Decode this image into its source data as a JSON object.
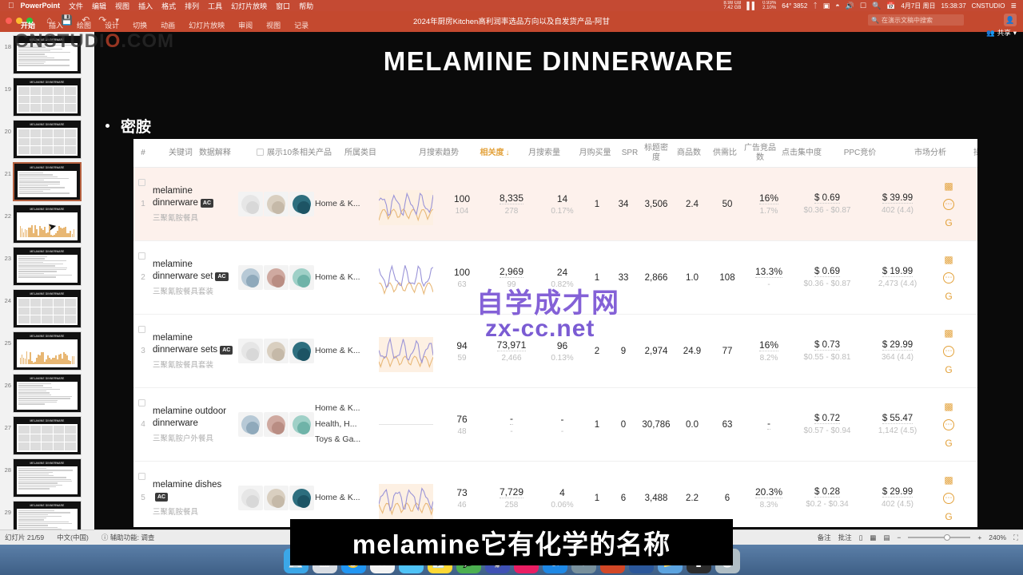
{
  "macos_menubar": {
    "apple_icon": "apple-icon",
    "app_name": "PowerPoint",
    "menus": [
      "文件",
      "编辑",
      "视图",
      "插入",
      "格式",
      "排列",
      "工具",
      "幻灯片放映",
      "窗口",
      "帮助"
    ],
    "net_up": "8.98 GB",
    "net_down": "7.42 GB",
    "cpu_pct": "0.93%",
    "mem_pct": "2.10%",
    "temp": "64° 3852",
    "date": "4月7日 周日",
    "time": "15:38:37",
    "user": "CNSTUDIO",
    "status_icons": [
      "bluetooth-icon",
      "display-icon",
      "wifi-icon",
      "volume-icon",
      "screenmirror-icon",
      "spotlight-icon",
      "controlcenter-icon",
      "list-icon"
    ]
  },
  "ppt_window": {
    "quick_access": [
      "home-icon",
      "save-icon",
      "undo-icon",
      "redo-icon",
      "more-icon"
    ],
    "document_title": "2024年厨房Kitchen高利润率选品方向以及自发货产品-阿甘",
    "search_placeholder": "在演示文稿中搜索",
    "share_label": "共享",
    "avatar_icon": "avatar-icon",
    "ribbon_tabs": [
      "开始",
      "插入",
      "绘图",
      "设计",
      "切换",
      "动画",
      "幻灯片放映",
      "审阅",
      "视图",
      "记录"
    ],
    "active_tab": "开始"
  },
  "slide_panel": {
    "thumbnails": [
      {
        "num": "18",
        "selected": false,
        "style": "doc"
      },
      {
        "num": "19",
        "selected": false,
        "style": "grid"
      },
      {
        "num": "20",
        "selected": false,
        "style": "grid"
      },
      {
        "num": "21",
        "selected": true,
        "style": "table"
      },
      {
        "num": "22",
        "selected": false,
        "style": "chart"
      },
      {
        "num": "23",
        "selected": false,
        "style": "table"
      },
      {
        "num": "24",
        "selected": false,
        "style": "grid"
      },
      {
        "num": "25",
        "selected": false,
        "style": "chart"
      },
      {
        "num": "26",
        "selected": false,
        "style": "doc"
      },
      {
        "num": "27",
        "selected": false,
        "style": "grid"
      },
      {
        "num": "28",
        "selected": false,
        "style": "doc"
      },
      {
        "num": "29",
        "selected": false,
        "style": "doc"
      }
    ]
  },
  "slide": {
    "title": "MELAMINE DINNERWARE",
    "bullet_text": "密胺",
    "watermark_logo": "CNSTUDIO.COM",
    "watermark_cn": "自学成才网",
    "watermark_url": "zx-cc.net"
  },
  "table": {
    "headers": {
      "index": "#",
      "keyword": "关键词",
      "data_explain": "数据解释",
      "show_related": "展示10条相关产品",
      "category": "所属类目",
      "trend": "月搜索趋势",
      "relevance": "相关度",
      "sort_arrow": "↓",
      "search_volume": "月搜索量",
      "purchase_volume": "月购买量",
      "spr": "SPR",
      "title_density": "标题密度",
      "goods_count": "商品数",
      "supply_demand": "供需比",
      "ad_competitors": "广告竞品数",
      "click_concentration": "点击集中度",
      "ppc_bid": "PPC竞价",
      "market_analysis": "市场分析",
      "actions": "操作"
    },
    "rows": [
      {
        "index": "1",
        "keyword_en": "melamine dinnerware",
        "badge": "AC",
        "keyword_cn": "三聚氰胺餐具",
        "categories": [
          "Home & K..."
        ],
        "relevance": "100",
        "relevance_sub": "104",
        "search_volume": "8,335",
        "search_volume_sub": "278",
        "purchase_volume": "14",
        "purchase_volume_sub": "0.17%",
        "spr": "1",
        "title_density": "34",
        "goods_count": "3,506",
        "supply_demand": "2.4",
        "ad_competitors": "50",
        "click_concentration": "16%",
        "click_concentration_sub": "1.7%",
        "ppc_bid": "$ 0.69",
        "ppc_range": "$0.36 - $0.87",
        "market_price": "$ 39.99",
        "market_sub": "402 (4.4)",
        "highlighted": true
      },
      {
        "index": "2",
        "keyword_en": "melamine dinnerware set",
        "badge": "AC",
        "keyword_cn": "三聚氰胺餐具套装",
        "categories": [
          "Home & K..."
        ],
        "relevance": "100",
        "relevance_sub": "63",
        "search_volume": "2,969",
        "search_volume_sub": "99",
        "purchase_volume": "24",
        "purchase_volume_sub": "0.82%",
        "spr": "1",
        "title_density": "33",
        "goods_count": "2,866",
        "supply_demand": "1.0",
        "ad_competitors": "108",
        "click_concentration": "13.3%",
        "click_concentration_sub": "-",
        "ppc_bid": "$ 0.69",
        "ppc_range": "$0.36 - $0.87",
        "market_price": "$ 19.99",
        "market_sub": "2,473 (4.4)",
        "highlighted": false
      },
      {
        "index": "3",
        "keyword_en": "melamine dinnerware sets",
        "badge": "AC",
        "keyword_cn": "三聚氰胺餐具套装",
        "categories": [
          "Home & K..."
        ],
        "relevance": "94",
        "relevance_sub": "59",
        "search_volume": "73,971",
        "search_volume_sub": "2,466",
        "purchase_volume": "96",
        "purchase_volume_sub": "0.13%",
        "spr": "2",
        "title_density": "9",
        "goods_count": "2,974",
        "supply_demand": "24.9",
        "ad_competitors": "77",
        "click_concentration": "16%",
        "click_concentration_sub": "8.2%",
        "ppc_bid": "$ 0.73",
        "ppc_range": "$0.55 - $0.81",
        "market_price": "$ 29.99",
        "market_sub": "364 (4.4)",
        "highlighted": false
      },
      {
        "index": "4",
        "keyword_en": "melamine outdoor dinnerware",
        "badge": "",
        "keyword_cn": "三聚氰胺户外餐具",
        "categories": [
          "Home & K...",
          "Health, H...",
          "Toys & Ga..."
        ],
        "relevance": "76",
        "relevance_sub": "48",
        "search_volume": "-",
        "search_volume_sub": "-",
        "purchase_volume": "-",
        "purchase_volume_sub": "-",
        "spr": "1",
        "title_density": "0",
        "goods_count": "30,786",
        "supply_demand": "0.0",
        "ad_competitors": "63",
        "click_concentration": "-",
        "click_concentration_sub": "",
        "ppc_bid": "$ 0.72",
        "ppc_range": "$0.57 - $0.94",
        "market_price": "$ 55.47",
        "market_sub": "1,142 (4.5)",
        "highlighted": false
      },
      {
        "index": "5",
        "keyword_en": "melamine dishes",
        "badge": "AC",
        "keyword_cn": "三聚氰胺餐具",
        "categories": [
          "Home & K..."
        ],
        "relevance": "73",
        "relevance_sub": "46",
        "search_volume": "7,729",
        "search_volume_sub": "258",
        "purchase_volume": "4",
        "purchase_volume_sub": "0.06%",
        "spr": "1",
        "title_density": "6",
        "goods_count": "3,488",
        "supply_demand": "2.2",
        "ad_competitors": "6",
        "click_concentration": "20.3%",
        "click_concentration_sub": "8.3%",
        "ppc_bid": "$ 0.28",
        "ppc_range": "$0.2 - $0.34",
        "market_price": "$ 29.99",
        "market_sub": "402 (4.5)",
        "highlighted": false
      }
    ]
  },
  "subtitle_overlay": {
    "text": "melamine它有化学的名称"
  },
  "status_bar": {
    "slide_counter": "幻灯片 21/59",
    "language": "中文(中国)",
    "accessibility": "辅助功能: 调查",
    "notes_label": "备注",
    "comments_label": "批注",
    "view_icons": [
      "normal-view-icon",
      "sorter-view-icon",
      "reading-view-icon",
      "slideshow-icon"
    ],
    "zoom_level": "240%",
    "fit_icon": "fit-slide-icon"
  },
  "dock": {
    "items": [
      "finder-icon",
      "launchpad-icon",
      "safari-icon",
      "chrome-icon",
      "mail-icon",
      "notes-icon",
      "wechat-icon",
      "qq-icon",
      "music-icon",
      "appstore-icon",
      "settings-icon",
      "powerpoint-icon",
      "word-icon",
      "folder-icon",
      "terminal-icon",
      "trash-icon"
    ]
  },
  "colors": {
    "ppt_orange": "#c4492f",
    "accent_gold": "#e3a23c",
    "row_highlight": "#fdf1ec",
    "slide_bg": "#0a0a0a"
  }
}
